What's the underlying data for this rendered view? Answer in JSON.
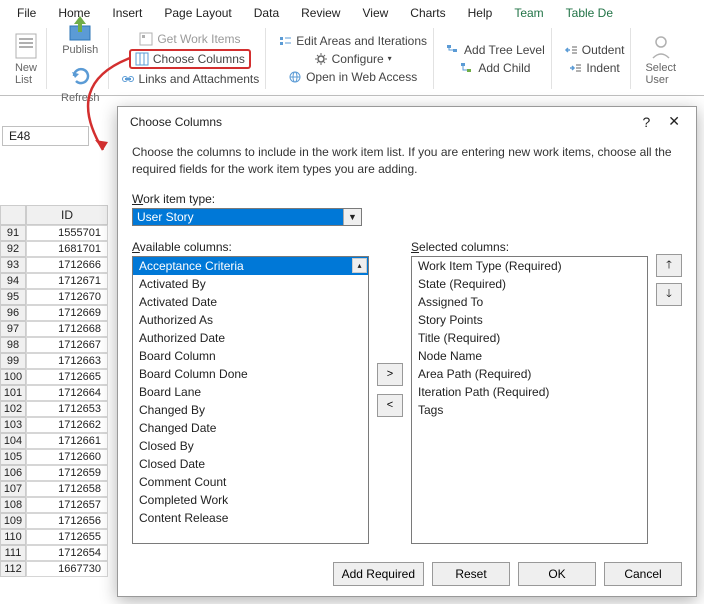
{
  "tabs": [
    "File",
    "Home",
    "Insert",
    "Page Layout",
    "Data",
    "Review",
    "View",
    "Charts",
    "Help",
    "Team",
    "Table De"
  ],
  "active_tab": "Team",
  "ribbon": {
    "new_list": "New\nList",
    "publish": "Publish",
    "refresh": "Refresh",
    "get_work_items": "Get Work Items",
    "choose_columns": "Choose Columns",
    "links_attachments": "Links and Attachments",
    "edit_areas": "Edit Areas and Iterations",
    "configure": "Configure",
    "open_web": "Open in Web Access",
    "add_tree_level": "Add Tree Level",
    "add_child": "Add Child",
    "outdent": "Outdent",
    "indent": "Indent",
    "select_user": "Select\nUser"
  },
  "namebox": "E48",
  "grid": {
    "col_header": "ID",
    "rows": [
      {
        "n": 91,
        "v": 1555701
      },
      {
        "n": 92,
        "v": 1681701
      },
      {
        "n": 93,
        "v": 1712666
      },
      {
        "n": 94,
        "v": 1712671
      },
      {
        "n": 95,
        "v": 1712670
      },
      {
        "n": 96,
        "v": 1712669
      },
      {
        "n": 97,
        "v": 1712668
      },
      {
        "n": 98,
        "v": 1712667
      },
      {
        "n": 99,
        "v": 1712663
      },
      {
        "n": 100,
        "v": 1712665
      },
      {
        "n": 101,
        "v": 1712664
      },
      {
        "n": 102,
        "v": 1712653
      },
      {
        "n": 103,
        "v": 1712662
      },
      {
        "n": 104,
        "v": 1712661
      },
      {
        "n": 105,
        "v": 1712660
      },
      {
        "n": 106,
        "v": 1712659
      },
      {
        "n": 107,
        "v": 1712658
      },
      {
        "n": 108,
        "v": 1712657
      },
      {
        "n": 109,
        "v": 1712656
      },
      {
        "n": 110,
        "v": 1712655
      },
      {
        "n": 111,
        "v": 1712654
      },
      {
        "n": 112,
        "v": 1667730
      }
    ]
  },
  "dialog": {
    "title": "Choose Columns",
    "help": "?",
    "close": "✕",
    "description": "Choose the columns to include in the work item list.  If you are entering new work items, choose all the required fields for the work item types you are adding.",
    "work_item_type_label": "Work item type:",
    "work_item_type": "User Story",
    "available_label": "Available columns:",
    "selected_label": "Selected columns:",
    "available": [
      "Acceptance Criteria",
      "Activated By",
      "Activated Date",
      "Authorized As",
      "Authorized Date",
      "Board Column",
      "Board Column Done",
      "Board Lane",
      "Changed By",
      "Changed Date",
      "Closed By",
      "Closed Date",
      "Comment Count",
      "Completed Work",
      "Content Release"
    ],
    "selected": [
      "Work Item Type (Required)",
      "State (Required)",
      "Assigned To",
      "Story Points",
      "Title (Required)",
      "Node Name",
      "Area Path (Required)",
      "Iteration Path (Required)",
      "Tags"
    ],
    "btn_add_required": "Add Required",
    "btn_reset": "Reset",
    "btn_ok": "OK",
    "btn_cancel": "Cancel"
  }
}
